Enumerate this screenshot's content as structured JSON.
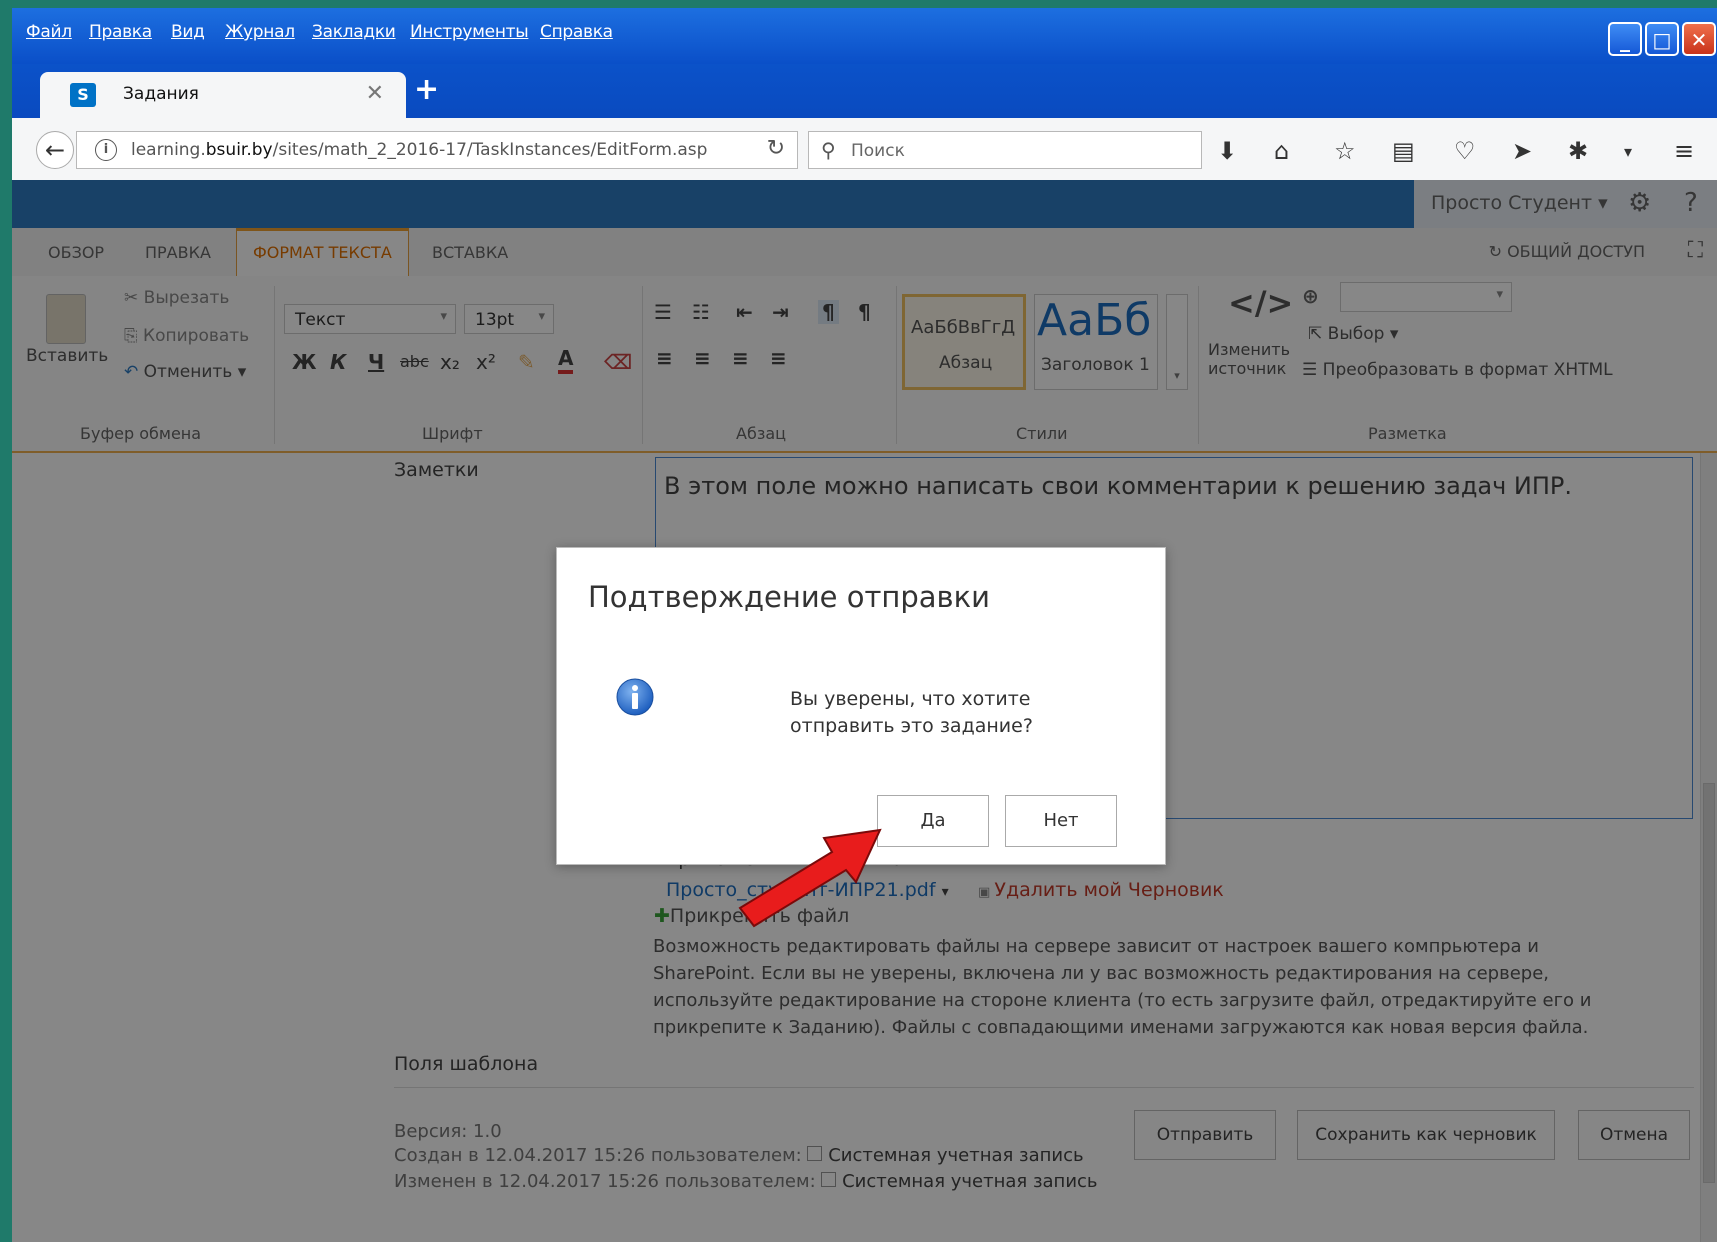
{
  "menu": [
    "Файл",
    "Правка",
    "Вид",
    "Журнал",
    "Закладки",
    "Инструменты",
    "Справка"
  ],
  "browser": {
    "tab_title": "Задания",
    "url_prefix": "learning.",
    "url_host": "bsuir.by",
    "url_path": "/sites/math_2_2016-17/TaskInstances/EditForm.asp",
    "search_placeholder": "Поиск"
  },
  "suite": {
    "user_name": "Просто Студент ▾",
    "help": "?"
  },
  "ribbon_tabs": [
    "ОБЗОР",
    "ПРАВКА",
    "ФОРМАТ ТЕКСТА",
    "ВСТАВКА"
  ],
  "share_label": "ОБЩИЙ ДОСТУП",
  "ribbon": {
    "paste": "Вставить",
    "cut": "Вырезать",
    "copy": "Копировать",
    "undo": "Отменить",
    "group_clipboard": "Буфер обмена",
    "font_name": "Текст",
    "font_size": "13pt",
    "bold": "Ж",
    "italic": "К",
    "underline": "Ч",
    "strike": "abc",
    "sub": "x₂",
    "sup": "x²",
    "group_font": "Шрифт",
    "group_paragraph": "Абзац",
    "style1_sample": "АаБбВвГгД",
    "style1_name": "Абзац",
    "style2_sample": "АаБб",
    "style2_name": "Заголовок 1",
    "group_styles": "Стили",
    "edit_source_1": "Изменить",
    "edit_source_2": "источник",
    "select": "Выбор ▾",
    "convert": "Преобразовать в формат XHTML",
    "group_markup": "Разметка"
  },
  "form": {
    "notes_label": "Заметки",
    "notes_text": "В этом поле можно написать свои комментарии к решению задач ИПР.",
    "attachments_label": "Приложения к заданию:",
    "file_name": "Просто_студент-ИПР21.pdf",
    "delete_draft": "Удалить мой Черновик",
    "attach_file": "Прикрепить файл",
    "info_lines": [
      "Возможность редактировать файлы на сервере зависит от настроек вашего компрьютера и",
      "SharePoint. Если вы не уверены, включена ли у вас возможность редактирования на сервере,",
      "используйте редактирование на стороне клиента (то есть загрузите файл, отредактируйте его и",
      "прикрепите к Заданию). Файлы с совпадающими именами загружаются как новая версия файла."
    ],
    "template_fields": "Поля шаблона",
    "version": "Версия: 1.0",
    "created": "Создан в 12.04.2017 15:26 пользователем:",
    "modified": "Изменен в 12.04.2017 15:26 пользователем:",
    "system_account": "Системная учетная запись",
    "submit": "Отправить",
    "save_draft": "Сохранить как черновик",
    "cancel": "Отмена"
  },
  "dialog": {
    "title": "Подтверждение отправки",
    "message_line1": "Вы уверены, что хотите",
    "message_line2": "отправить это задание?",
    "yes": "Да",
    "no": "Нет"
  },
  "colors": {
    "suite_blue": "#2f7bc2",
    "accent_orange": "#f0a030",
    "link_blue": "#1e6fc0",
    "delete_red": "#c23a28",
    "arrow_red": "#e81c1c"
  }
}
